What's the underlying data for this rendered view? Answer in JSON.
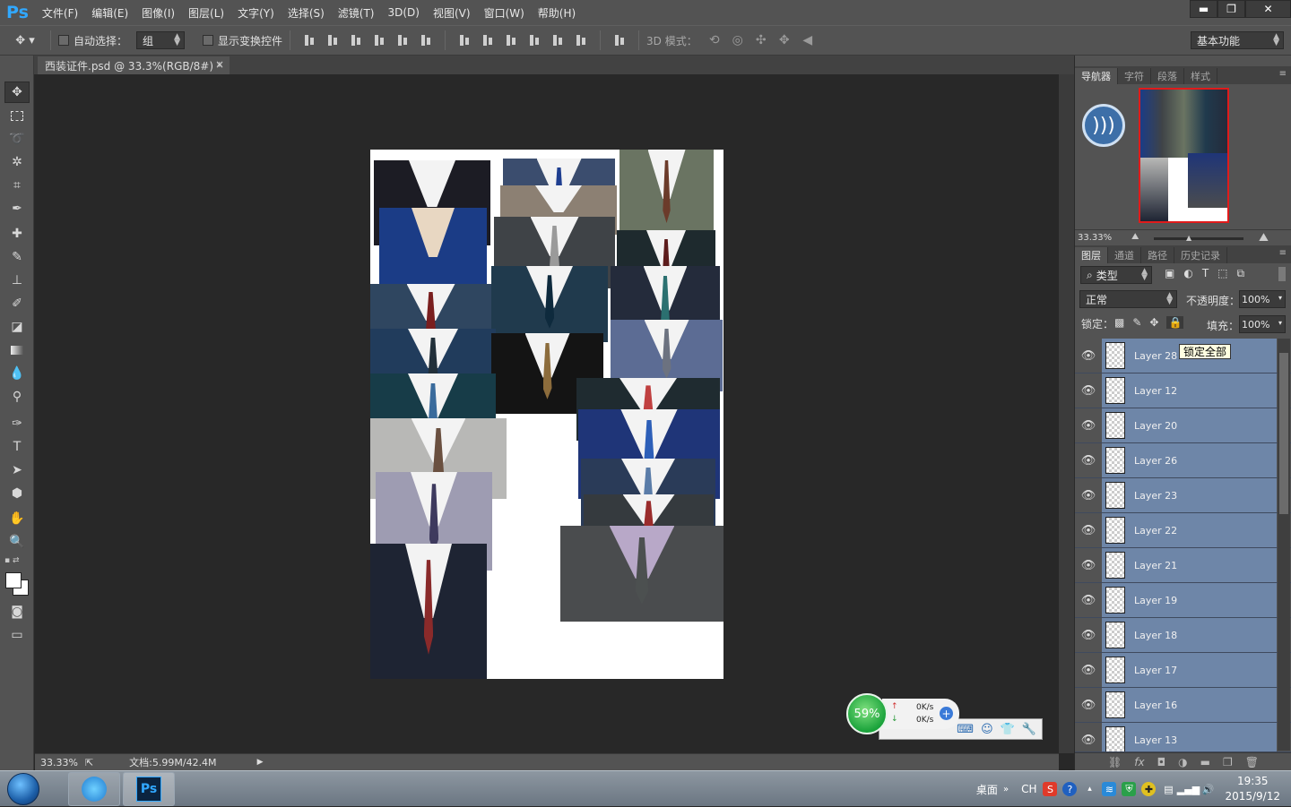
{
  "app": {
    "logo": "Ps"
  },
  "menu": [
    "文件(F)",
    "编辑(E)",
    "图像(I)",
    "图层(L)",
    "文字(Y)",
    "选择(S)",
    "滤镜(T)",
    "3D(D)",
    "视图(V)",
    "窗口(W)",
    "帮助(H)"
  ],
  "window_controls": {
    "minimize": "▬",
    "restore": "❐",
    "close": "✕"
  },
  "options": {
    "auto_select_label": "自动选择：",
    "auto_select_value": "组",
    "show_transform_label": "显示变换控件",
    "mode3d_label": "3D 模式：",
    "workspace": "基本功能"
  },
  "document": {
    "tab_title": "西装证件.psd @ 33.3%(RGB/8#) *",
    "tab_close": "×"
  },
  "status": {
    "zoom": "33.33%",
    "doc_info": "文档:5.99M/42.4M"
  },
  "navigator": {
    "tabs": [
      "导航器",
      "字符",
      "段落",
      "样式"
    ],
    "zoom": "33.33%"
  },
  "layers_panel": {
    "tabs": [
      "图层",
      "通道",
      "路径",
      "历史记录"
    ],
    "filter_label": "类型",
    "blend_mode": "正常",
    "opacity_label": "不透明度：",
    "opacity": "100%",
    "lock_label": "锁定：",
    "fill_label": "填充：",
    "fill": "100%",
    "tooltip": "锁定全部",
    "layers": [
      "Layer 28",
      "Layer 12",
      "Layer 20",
      "Layer 26",
      "Layer 23",
      "Layer 22",
      "Layer 21",
      "Layer 19",
      "Layer 18",
      "Layer 17",
      "Layer 16",
      "Layer 13"
    ]
  },
  "speed_widget": {
    "percent": "59%",
    "up": "0K/s",
    "down": "0K/s"
  },
  "taskbar": {
    "desktop_label": "桌面",
    "ime": "CH",
    "time": "19:35",
    "date": "2015/9/12"
  },
  "colors": {
    "accent": "#31a8ff",
    "layer_selected": "#6e86a8",
    "ui_panel": "#535353"
  }
}
